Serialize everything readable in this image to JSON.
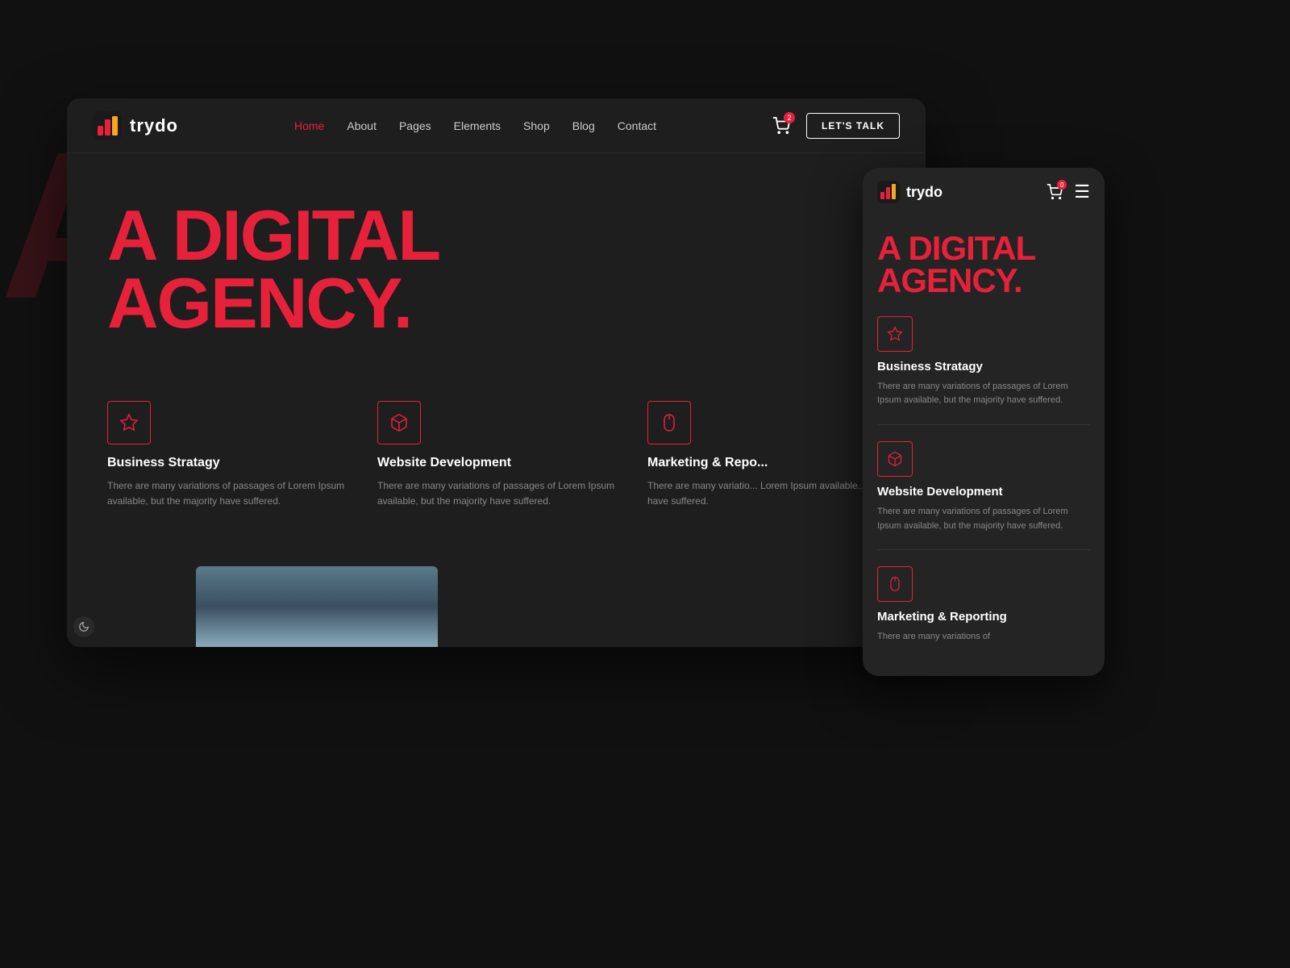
{
  "brand": {
    "name": "trydo"
  },
  "desktop": {
    "nav": {
      "links": [
        {
          "label": "Home",
          "active": true
        },
        {
          "label": "About",
          "active": false
        },
        {
          "label": "Pages",
          "active": false
        },
        {
          "label": "Elements",
          "active": false
        },
        {
          "label": "Shop",
          "active": false
        },
        {
          "label": "Blog",
          "active": false
        },
        {
          "label": "Contact",
          "active": false
        }
      ],
      "cart_count": "2",
      "cta_label": "LET'S TALK"
    },
    "hero": {
      "line1": "A DIGITAL",
      "line2": "AGENCY."
    },
    "services": [
      {
        "icon_type": "star",
        "title": "Business Stratagy",
        "desc": "There are many variations of passages of Lorem Ipsum available, but the majority have suffered."
      },
      {
        "icon_type": "box",
        "title": "Website Development",
        "desc": "There are many variations of passages of Lorem Ipsum available, but the majority have suffered."
      },
      {
        "icon_type": "mouse",
        "title": "Marketing & Repo...",
        "desc": "There are many variatio... Lorem Ipsum available... have suffered."
      }
    ]
  },
  "mobile": {
    "nav": {
      "cart_count": "0"
    },
    "hero": {
      "line1": "A DIGITAL",
      "line2": "AGENCY."
    },
    "services": [
      {
        "icon_type": "star",
        "title": "Business Stratagy",
        "desc": "There are many variations of passages of Lorem Ipsum available, but the majority have suffered."
      },
      {
        "icon_type": "box",
        "title": "Website Development",
        "desc": "There are many variations of passages of Lorem Ipsum available, but the majority have suffered."
      },
      {
        "icon_type": "mouse",
        "title": "Marketing & Reporting",
        "desc": "There are many variations of"
      }
    ]
  },
  "background_text": "A AG"
}
